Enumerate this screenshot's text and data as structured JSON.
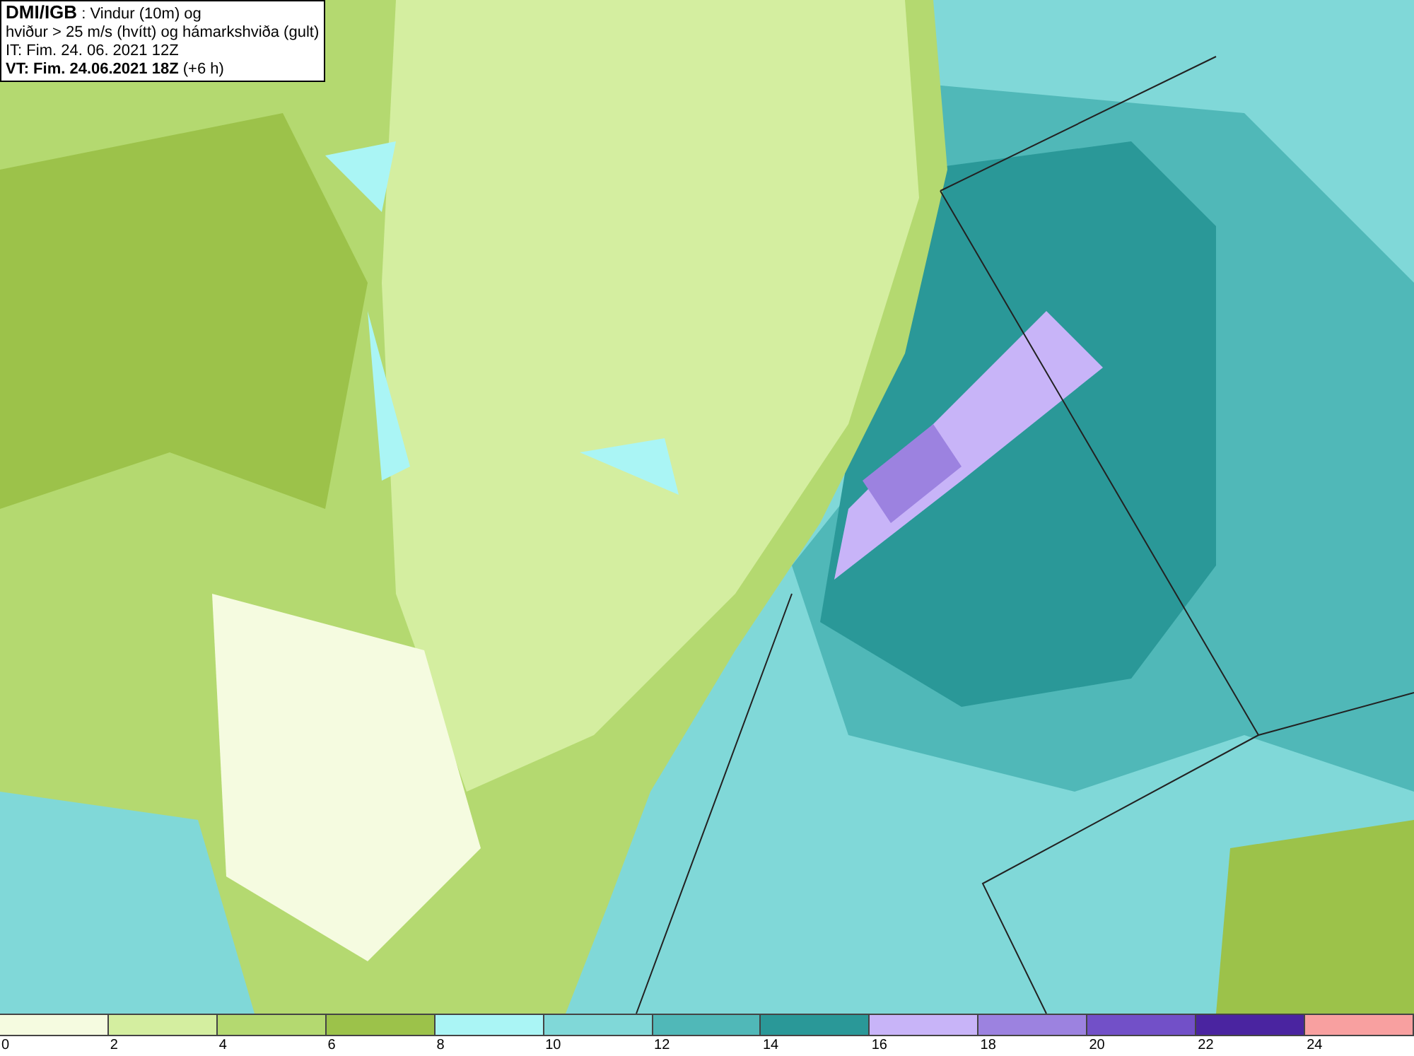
{
  "title_box": {
    "lines": [
      "**DMI/IGB** : Vindur (10m) og",
      "hviður > 25 m/s (hvítt) og hámarkshviða (gult)",
      "IT: Fim. 24. 06. 2021 12Z",
      "**VT: Fim. 24.06.2021 18Z** (+6 h)"
    ]
  },
  "legend": {
    "swatches": [
      {
        "color": "#f5fbe0",
        "label": "0"
      },
      {
        "color": "#d4eea0",
        "label": "2"
      },
      {
        "color": "#b4d970",
        "label": "4"
      },
      {
        "color": "#9cc24a",
        "label": "6"
      },
      {
        "color": "#aaf5f5",
        "label": "8"
      },
      {
        "color": "#80d8d8",
        "label": "10"
      },
      {
        "color": "#50b8b8",
        "label": "12"
      },
      {
        "color": "#2a9898",
        "label": "14"
      },
      {
        "color": "#c8b4f8",
        "label": "16"
      },
      {
        "color": "#9c82e0",
        "label": "18"
      },
      {
        "color": "#7250c8",
        "label": "20"
      },
      {
        "color": "#4a24a0",
        "label": "22"
      },
      {
        "color": "#f8a0a0",
        "label": "24"
      }
    ]
  }
}
